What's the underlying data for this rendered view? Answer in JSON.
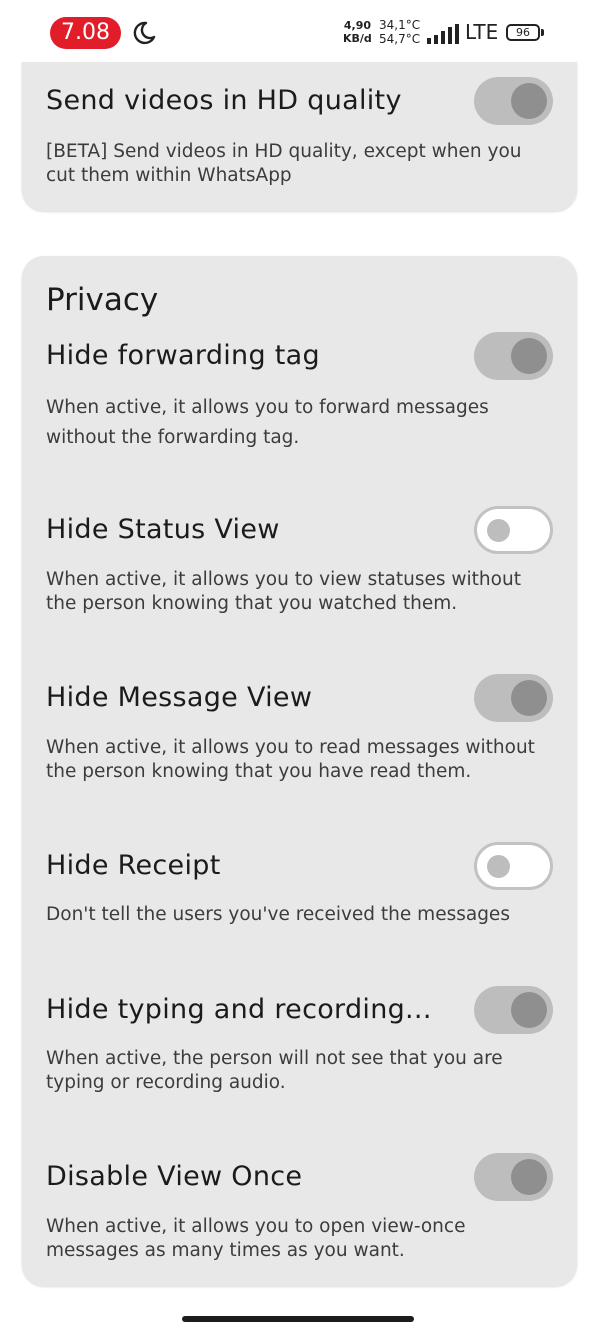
{
  "status_bar": {
    "time": "7.08",
    "net_speed_value": "4,90",
    "net_speed_unit": "KB/d",
    "temp1": "34,1°C",
    "temp2": "54,7°C",
    "network": "LTE",
    "battery": "96"
  },
  "top_card": {
    "title": "Send videos in HD quality",
    "description": "[BETA] Send videos in HD quality, except when you cut them within WhatsApp",
    "toggle_on": true
  },
  "privacy": {
    "heading": "Privacy",
    "items": [
      {
        "title": "Hide forwarding tag",
        "description": "When active, it allows you to forward messages without the forwarding tag.",
        "toggle_on": true
      },
      {
        "title": "Hide Status View",
        "description": "When active, it allows you to view statuses without the person knowing that you watched them.",
        "toggle_on": false
      },
      {
        "title": "Hide Message View",
        "description": "When active, it allows you to read messages without the person knowing that you have read them.",
        "toggle_on": true
      },
      {
        "title": "Hide Receipt",
        "description": "Don't tell the users you've received the messages",
        "toggle_on": false
      },
      {
        "title": "Hide typing and recording...",
        "description": "When active, the person will not see that you are typing or recording audio.",
        "toggle_on": true
      },
      {
        "title": "Disable View Once",
        "description": "When active, it allows you to open view-once messages as many times as you want.",
        "toggle_on": true
      }
    ]
  }
}
